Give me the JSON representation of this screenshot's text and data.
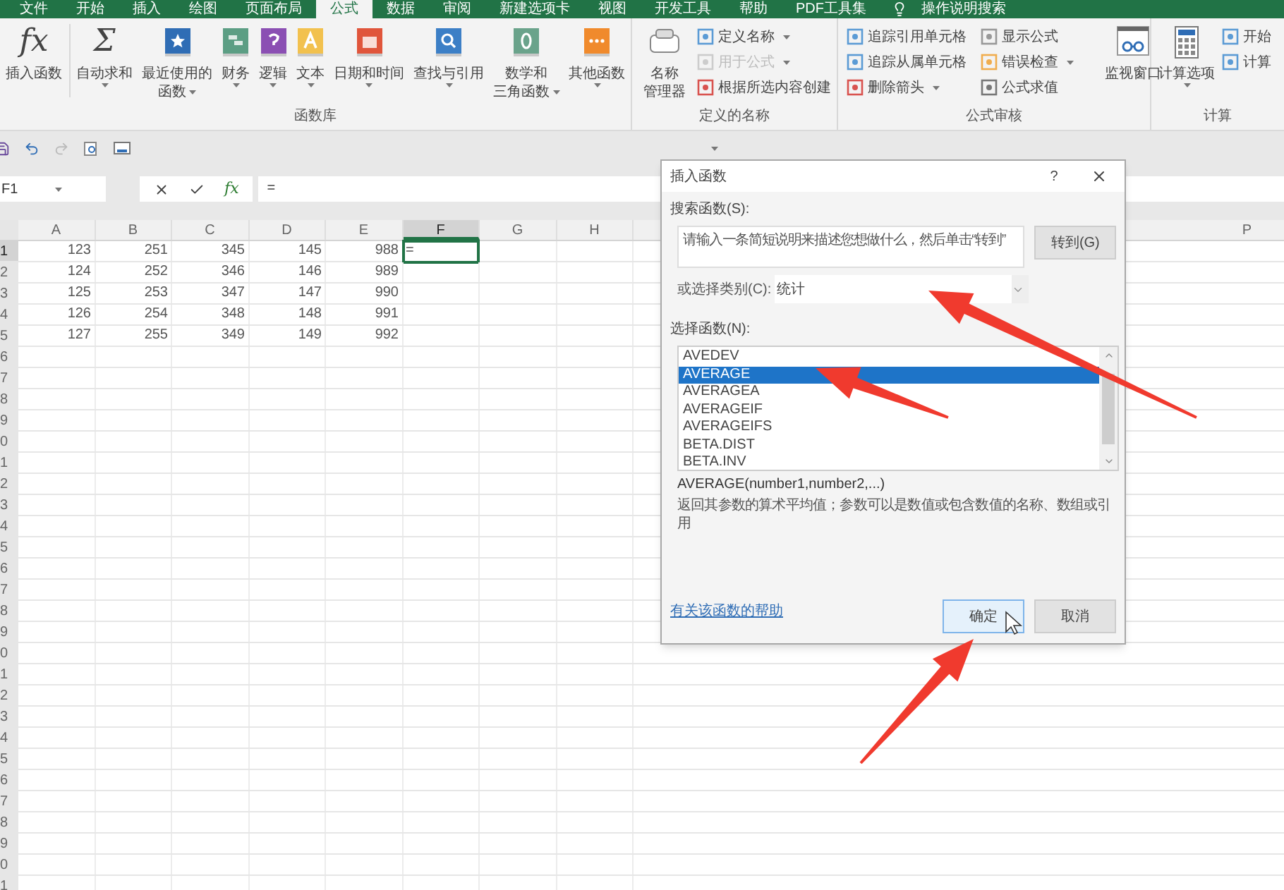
{
  "ribbon_tabs": [
    {
      "label": "文件",
      "selected": false
    },
    {
      "label": "开始",
      "selected": false
    },
    {
      "label": "插入",
      "selected": false
    },
    {
      "label": "绘图",
      "selected": false
    },
    {
      "label": "页面布局",
      "selected": false
    },
    {
      "label": "公式",
      "selected": true
    },
    {
      "label": "数据",
      "selected": false
    },
    {
      "label": "审阅",
      "selected": false
    },
    {
      "label": "新建选项卡",
      "selected": false
    },
    {
      "label": "视图",
      "selected": false
    },
    {
      "label": "开发工具",
      "selected": false
    },
    {
      "label": "帮助",
      "selected": false
    },
    {
      "label": "PDF工具集",
      "selected": false
    }
  ],
  "tell_me": "操作说明搜索",
  "ribbon_groups": [
    {
      "kind": "large_buttons",
      "label": "函数库",
      "buttons": [
        {
          "glyph": "fx",
          "lines": [
            "插入函数"
          ],
          "dropdown": false
        },
        {
          "glyph": "Σ",
          "lines": [
            "自动求和"
          ],
          "dropdown": true
        },
        {
          "lines": [
            "最近使用的",
            "函数"
          ],
          "dropdown": true
        },
        {
          "lines": [
            "财务"
          ],
          "dropdown": true
        },
        {
          "lines": [
            "逻辑"
          ],
          "dropdown": true
        },
        {
          "lines": [
            "文本"
          ],
          "dropdown": true
        },
        {
          "lines": [
            "日期和时间"
          ],
          "dropdown": true
        },
        {
          "lines": [
            "查找与引用"
          ],
          "dropdown": true
        },
        {
          "lines": [
            "数学和",
            "三角函数"
          ],
          "dropdown": true
        },
        {
          "lines": [
            "其他函数"
          ],
          "dropdown": true
        }
      ]
    },
    {
      "kind": "names",
      "label": "定义的名称",
      "buttons": [
        {
          "lines": [
            "名称",
            "管理器"
          ],
          "dropdown": false
        }
      ],
      "small_items": [
        {
          "label": "定义名称",
          "dropdown": true,
          "disabled": false
        },
        {
          "label": "用于公式",
          "dropdown": true,
          "disabled": true
        },
        {
          "label": "根据所选内容创建",
          "dropdown": false,
          "disabled": false
        }
      ]
    },
    {
      "kind": "auditing",
      "label": "公式审核",
      "small_items": [
        {
          "label": "追踪引用单元格",
          "dropdown": false,
          "disabled": false
        },
        {
          "label": "追踪从属单元格",
          "dropdown": false,
          "disabled": false
        },
        {
          "label": "删除箭头",
          "dropdown": true,
          "disabled": false
        },
        {
          "label": "显示公式",
          "dropdown": false,
          "disabled": false
        },
        {
          "label": "错误检查",
          "dropdown": true,
          "disabled": false
        },
        {
          "label": "公式求值",
          "dropdown": false,
          "disabled": false
        }
      ],
      "buttons": [
        {
          "lines": [
            "监视窗口"
          ],
          "dropdown": false
        }
      ]
    },
    {
      "kind": "calculation",
      "label": "计算",
      "buttons": [
        {
          "lines": [
            "计算选项"
          ],
          "dropdown": true
        }
      ],
      "small_items": [
        {
          "label": "开始",
          "dropdown": false,
          "disabled": false
        },
        {
          "label": "计算",
          "dropdown": false,
          "disabled": false
        }
      ]
    }
  ],
  "name_box": "F1",
  "formula_glyph": "fx",
  "formula": "=",
  "columns": [
    "A",
    "B",
    "C",
    "D",
    "E",
    "F",
    "G",
    "H"
  ],
  "far_columns": [
    "P"
  ],
  "rows": [
    {
      "header": "1",
      "cells": [
        {
          "value": "123",
          "selected": false
        },
        {
          "value": "251",
          "selected": false
        },
        {
          "value": "345",
          "selected": false
        },
        {
          "value": "145",
          "selected": false
        },
        {
          "value": "988",
          "selected": false
        },
        {
          "value": "=",
          "selected": true
        }
      ]
    },
    {
      "header": "2",
      "cells": [
        {
          "value": "124",
          "selected": false
        },
        {
          "value": "252",
          "selected": false
        },
        {
          "value": "346",
          "selected": false
        },
        {
          "value": "146",
          "selected": false
        },
        {
          "value": "989",
          "selected": false
        }
      ]
    },
    {
      "header": "3",
      "cells": [
        {
          "value": "125",
          "selected": false
        },
        {
          "value": "253",
          "selected": false
        },
        {
          "value": "347",
          "selected": false
        },
        {
          "value": "147",
          "selected": false
        },
        {
          "value": "990",
          "selected": false
        }
      ]
    },
    {
      "header": "4",
      "cells": [
        {
          "value": "126",
          "selected": false
        },
        {
          "value": "254",
          "selected": false
        },
        {
          "value": "348",
          "selected": false
        },
        {
          "value": "148",
          "selected": false
        },
        {
          "value": "991",
          "selected": false
        }
      ]
    },
    {
      "header": "5",
      "cells": [
        {
          "value": "127",
          "selected": false
        },
        {
          "value": "255",
          "selected": false
        },
        {
          "value": "349",
          "selected": false
        },
        {
          "value": "149",
          "selected": false
        },
        {
          "value": "992",
          "selected": false
        }
      ]
    },
    {
      "header": "6"
    },
    {
      "header": "7"
    },
    {
      "header": "8"
    },
    {
      "header": "9"
    },
    {
      "header": "0"
    },
    {
      "header": "1"
    },
    {
      "header": "2"
    },
    {
      "header": "3"
    },
    {
      "header": "4"
    },
    {
      "header": "5"
    },
    {
      "header": "6"
    },
    {
      "header": "7"
    },
    {
      "header": "8"
    },
    {
      "header": "9"
    },
    {
      "header": "0"
    },
    {
      "header": "1"
    },
    {
      "header": "2"
    },
    {
      "header": "3"
    },
    {
      "header": "4"
    },
    {
      "header": "5"
    },
    {
      "header": "6"
    },
    {
      "header": "7"
    },
    {
      "header": "8"
    },
    {
      "header": "9"
    },
    {
      "header": "0"
    },
    {
      "header": "1"
    }
  ],
  "dialog": {
    "title": "插入函数",
    "help": "?",
    "search_label": "搜索函数(S):",
    "search_value": "请输入一条简短说明来描述您想做什么，然后单击“转到”",
    "go_button": "转到(G)",
    "category_label": "或选择类别(C):",
    "category_value": "统计",
    "list_label": "选择函数(N):",
    "functions": [
      {
        "name": "AVEDEV",
        "selected": false
      },
      {
        "name": "AVERAGE",
        "selected": true
      },
      {
        "name": "AVERAGEA",
        "selected": false
      },
      {
        "name": "AVERAGEIF",
        "selected": false
      },
      {
        "name": "AVERAGEIFS",
        "selected": false
      },
      {
        "name": "BETA.DIST",
        "selected": false
      },
      {
        "name": "BETA.INV",
        "selected": false
      }
    ],
    "signature": "AVERAGE(number1,number2,...)",
    "description": "返回其参数的算术平均值；参数可以是数值或包含数值的名称、数组或引用",
    "help_link": "有关该函数的帮助",
    "ok": "确定",
    "cancel": "取消"
  }
}
